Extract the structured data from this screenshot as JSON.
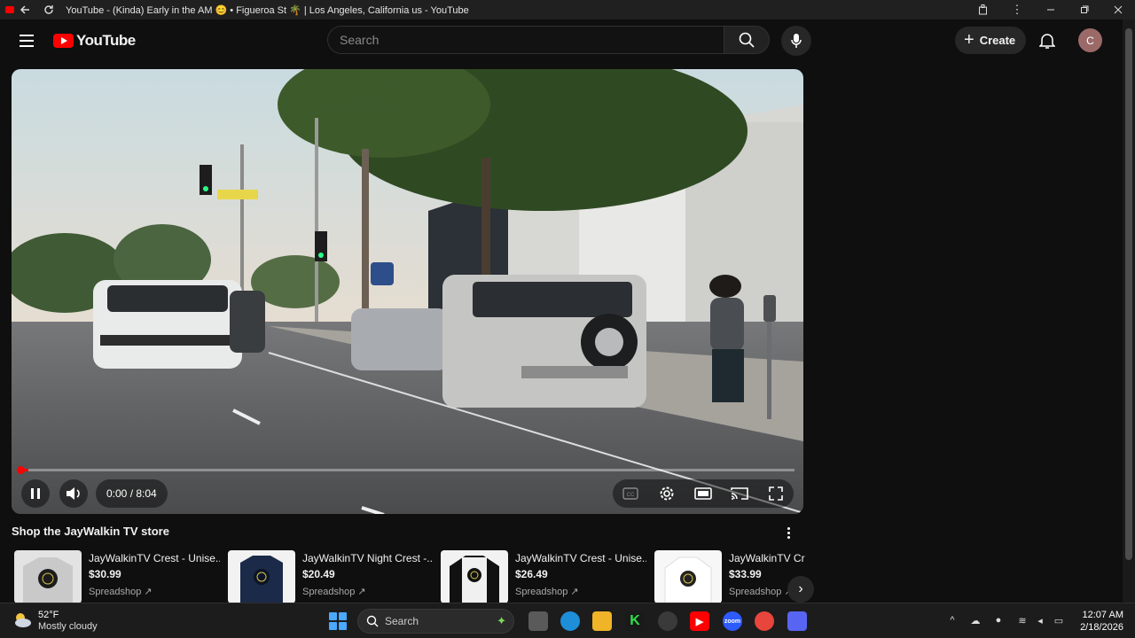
{
  "browser": {
    "tab_title": "YouTube - (Kinda) Early in the AM 😊 • Figueroa St 🌴 | Los Angeles, California us - YouTube"
  },
  "header": {
    "logo_text": "YouTube",
    "search_placeholder": "Search",
    "create_label": "Create",
    "avatar_letter": "C"
  },
  "player": {
    "time_display": "0:00 / 8:04",
    "progress_fraction": 0.01,
    "state": "playing"
  },
  "shop": {
    "title": "Shop the JayWalkin TV store",
    "products": [
      {
        "name": "JayWalkinTV Crest - Unise...",
        "price": "$30.99",
        "vendor": "Spreadshop",
        "style": "gray-crewneck"
      },
      {
        "name": "JayWalkinTV Night Crest -...",
        "price": "$20.49",
        "vendor": "Spreadshop",
        "style": "navy-tee"
      },
      {
        "name": "JayWalkinTV Crest - Unise...",
        "price": "$26.49",
        "vendor": "Spreadshop",
        "style": "raglan"
      },
      {
        "name": "JayWalkinTV Cre",
        "price": "$33.99",
        "vendor": "Spreadshop",
        "style": "white-hoodie"
      }
    ]
  },
  "taskbar": {
    "temperature": "52°F",
    "condition": "Mostly cloudy",
    "search_label": "Search",
    "time": "12:07 AM",
    "date": "2/18/2026"
  },
  "colors": {
    "brand_red": "#ff0000",
    "background": "#0f0f0f"
  }
}
